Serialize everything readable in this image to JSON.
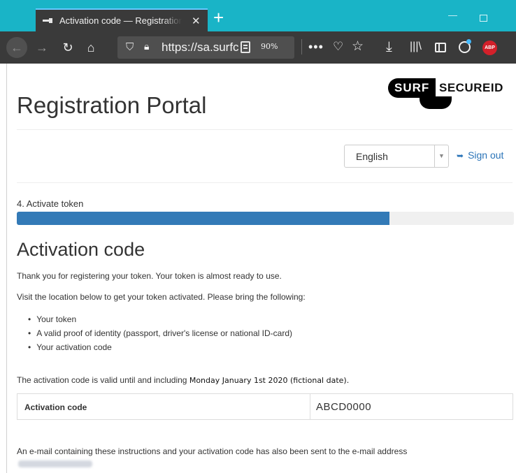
{
  "browser": {
    "tab_title": "Activation code — Registration Portal",
    "tab_close": "✕",
    "new_tab": "+",
    "url": "https://sa.surfconext.nl",
    "zoom": "90%",
    "more_actions": "•••",
    "abp_label": "ABP",
    "icons": [
      "back-arrow-icon",
      "forward-arrow-icon",
      "reload-icon",
      "home-icon",
      "shield-icon",
      "lock-icon",
      "reader-view-icon",
      "pocket-icon",
      "star-icon",
      "download-icon",
      "library-icon",
      "sidebar-icon",
      "account-icon",
      "adblock-icon"
    ],
    "colors": {
      "tabstrip": "#19b4c7",
      "toolbar": "#3a3a3a",
      "urlbar": "#4f4f4f"
    }
  },
  "header": {
    "portal_title": "Registration Portal",
    "logo_surf": "SURF",
    "logo_secureid": "SECUREID"
  },
  "language": {
    "selected": "English"
  },
  "signout_label": "Sign out",
  "progress": {
    "step_label": "4. Activate token",
    "fraction": 0.75,
    "color": "#337ab7"
  },
  "main": {
    "heading": "Activation code",
    "intro": "Thank you for registering your token. Your token is almost ready to use.",
    "visit": "Visit the location below to get your token activated. Please bring the following:",
    "requirements": [
      "Your token",
      "A valid proof of identity (passport, driver's license or national ID-card)",
      "Your activation code"
    ],
    "valid_prefix": "The activation code is valid until and including ",
    "valid_date": "Monday January 1st 2020 (fictional date).",
    "code_label": "Activation code",
    "code_value": "ABCD0000",
    "email_notice": "An e-mail containing these instructions and your activation code has also been sent to the e-mail address"
  }
}
